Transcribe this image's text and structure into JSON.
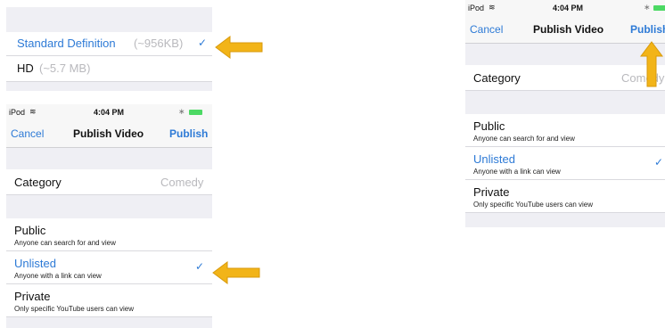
{
  "quality_panel": {
    "options": [
      {
        "label": "Standard Definition",
        "size": "(~956KB)",
        "selected": true
      },
      {
        "label": "HD",
        "size": "(~5.7 MB)",
        "selected": false
      }
    ],
    "check_glyph": "✓"
  },
  "screen_left": {
    "status": {
      "carrier": "iPod",
      "time": "4:04 PM"
    },
    "nav": {
      "cancel": "Cancel",
      "title": "Publish Video",
      "publish": "Publish"
    },
    "category": {
      "label": "Category",
      "value": "Comedy"
    },
    "privacy": [
      {
        "title": "Public",
        "subtitle": "Anyone can search for and view",
        "selected": false
      },
      {
        "title": "Unlisted",
        "subtitle": "Anyone with a link can view",
        "selected": true
      },
      {
        "title": "Private",
        "subtitle": "Only specific YouTube users can view",
        "selected": false
      }
    ]
  },
  "screen_right": {
    "status": {
      "carrier": "iPod",
      "time": "4:04 PM"
    },
    "nav": {
      "cancel": "Cancel",
      "title": "Publish Video",
      "publish": "Publish"
    },
    "category": {
      "label": "Category",
      "value": "Comedy"
    },
    "privacy": [
      {
        "title": "Public",
        "subtitle": "Anyone can search for and view",
        "selected": false
      },
      {
        "title": "Unlisted",
        "subtitle": "Anyone with a link can view",
        "selected": true
      },
      {
        "title": "Private",
        "subtitle": "Only specific YouTube users can view",
        "selected": false
      }
    ]
  },
  "colors": {
    "accent": "#2d7ad6",
    "arrow": "#f2b418",
    "group_bg": "#efeff4"
  }
}
